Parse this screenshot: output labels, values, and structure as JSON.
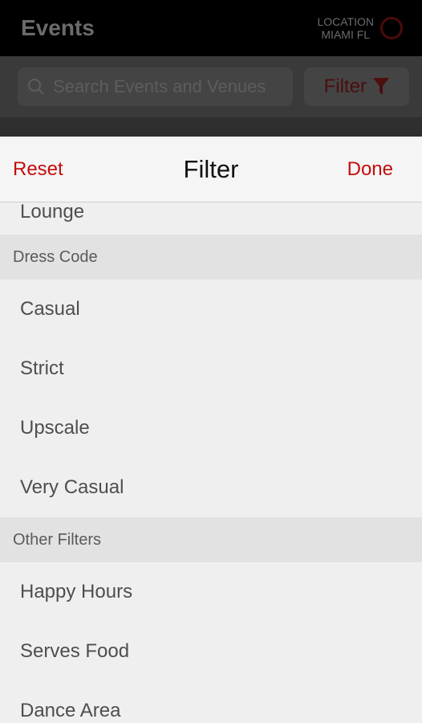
{
  "app": {
    "title": "Events",
    "location_label": "LOCATION",
    "location_value": "MIAMI FL"
  },
  "search": {
    "placeholder": "Search Events and Venues",
    "filter_label": "Filter"
  },
  "filter_sheet": {
    "reset_label": "Reset",
    "title": "Filter",
    "done_label": "Done",
    "partial_item": "Lounge",
    "sections": [
      {
        "title": "Dress Code",
        "items": [
          "Casual",
          "Strict",
          "Upscale",
          "Very Casual"
        ]
      },
      {
        "title": "Other Filters",
        "items": [
          "Happy Hours",
          "Serves Food",
          "Dance Area"
        ]
      }
    ]
  },
  "colors": {
    "accent": "#c40c0c",
    "header_bg": "#000000",
    "sheet_bg": "#efefef",
    "section_bg": "#e2e2e2"
  }
}
